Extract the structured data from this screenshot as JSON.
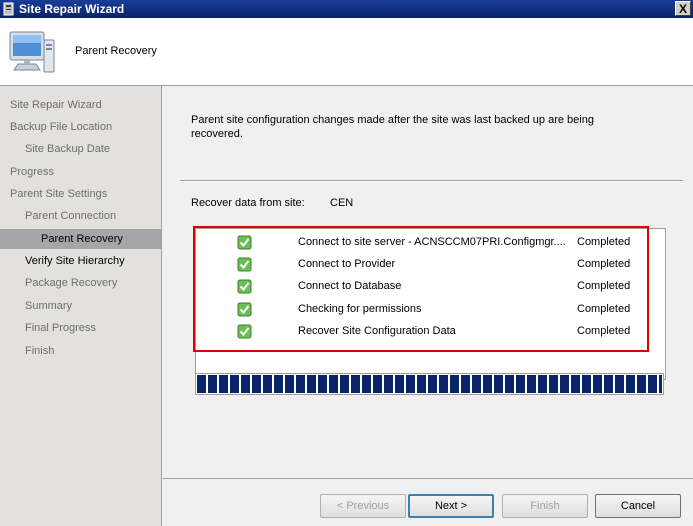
{
  "window": {
    "title": "Site Repair Wizard",
    "close_glyph": "X"
  },
  "header": {
    "title": "Parent Recovery",
    "icon": "computer-monitor-icon"
  },
  "sidebar": {
    "items": [
      {
        "label": "Site Repair Wizard",
        "state": "normal"
      },
      {
        "label": "Backup File Location",
        "state": "normal"
      },
      {
        "label": "Site Backup Date",
        "state": "normal"
      },
      {
        "label": "Progress",
        "state": "normal"
      },
      {
        "label": "Parent Site Settings",
        "state": "normal"
      },
      {
        "label": "Parent Connection",
        "state": "normal"
      },
      {
        "label": "Parent Recovery",
        "state": "current"
      },
      {
        "label": "Verify Site Hierarchy",
        "state": "bold"
      },
      {
        "label": "Package Recovery",
        "state": "normal"
      },
      {
        "label": "Summary",
        "state": "normal"
      },
      {
        "label": "Final Progress",
        "state": "normal"
      },
      {
        "label": "Finish",
        "state": "normal"
      }
    ]
  },
  "content": {
    "description": "Parent site configuration changes made after the site was last backed up are being recovered.",
    "recover_label": "Recover data from site:",
    "recover_site": "CEN",
    "tasks": [
      {
        "task": "Connect to site server - ACNSCCM07PRI.Configmgr....",
        "status": "Completed",
        "icon": "check-icon"
      },
      {
        "task": "Connect to Provider",
        "status": "Completed",
        "icon": "check-icon"
      },
      {
        "task": "Connect to Database",
        "status": "Completed",
        "icon": "check-icon"
      },
      {
        "task": "Checking for permissions",
        "status": "Completed",
        "icon": "check-icon"
      },
      {
        "task": "Recover Site Configuration Data",
        "status": "Completed",
        "icon": "check-icon"
      }
    ],
    "progress_percent": 100,
    "highlight_color": "#e10000",
    "progress_color": "#0a246a"
  },
  "buttons": {
    "previous": "< Previous",
    "next": "Next >",
    "finish": "Finish",
    "cancel": "Cancel"
  }
}
